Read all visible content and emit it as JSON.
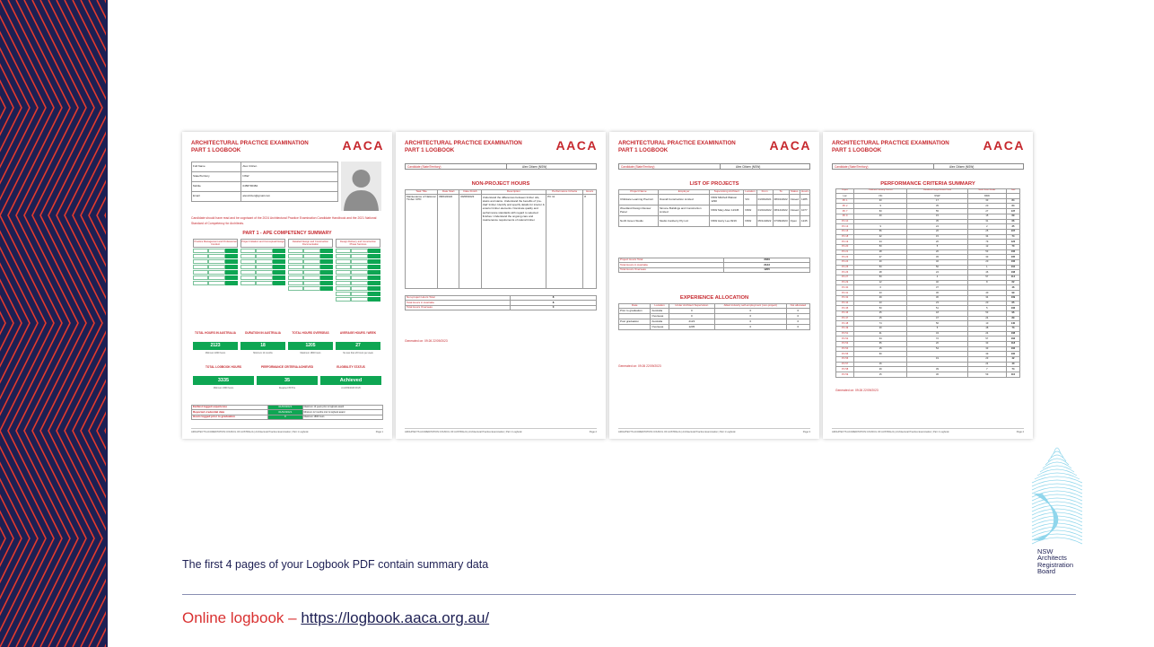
{
  "slide": {
    "caption": "The first 4 pages of your Logbook PDF contain summary data",
    "online_label": "Online logbook – ",
    "online_link": "https://logbook.aaca.org.au/",
    "brand_color": "#c6282e",
    "navy_color": "#1d1f53",
    "green_color": "#0ea653"
  },
  "logo": {
    "lines": [
      "NSW",
      "Architects",
      "Registration",
      "Board"
    ]
  },
  "doc": {
    "title_line1": "ARCHITECTURAL PRACTICE EXAMINATION",
    "title_line2": "PART 1 LOGBOOK",
    "logo_text": "AACA",
    "footer": "ARCHITECTS ACCREDITATION COUNCIL OF AUSTRALIA | Architectural Practice Examination | Part 1 Logbook",
    "generated": "Generated on: 09:26 22/09/2023",
    "candidate_label": "Candidate (State/Territory)",
    "candidate_value": "Alex Citizen  (NSW)"
  },
  "page1": {
    "page_num": "Page 1",
    "info": [
      {
        "label": "Full Name",
        "value": "Alex Citizen"
      },
      {
        "label": "State/Territory",
        "value": "NSW"
      },
      {
        "label": "Mobile",
        "value": "0458736384"
      },
      {
        "label": "Email",
        "value": "alexcitizen@gmail.com"
      }
    ],
    "disclaimer": "Candidate should have read and be cognisant of the 2024 Architectural Practice Examination Candidate Handbook and the 2021 National Standard of Competency for Architects.",
    "section_title": "PART 1 - APE COMPETENCY SUMMARY",
    "columns": [
      "Practice Management and Professional Conduct",
      "Project Initiation and Conceptual Design",
      "Detailed Design and Construction Documentation",
      "Design Delivery and Construction Phase Services"
    ],
    "stats1": [
      {
        "label": "TOTAL HOURS IN AUSTRALIA",
        "value": "2123",
        "note": "Minimum 1800 hours"
      },
      {
        "label": "DURATION IN AUSTRALIA",
        "value": "18",
        "note": "Minimum 12 months"
      },
      {
        "label": "TOTAL HOURS OVERSEAS",
        "value": "1205",
        "note": "Maximum 1800 hours"
      },
      {
        "label": "AVERAGE HOURS / WEEK",
        "value": "27",
        "note": "No less than 20 hours per week"
      }
    ],
    "stats2": [
      {
        "label": "TOTAL LOGBOOK HOURS",
        "value": "3335",
        "note": "Minimum 3300 hours"
      },
      {
        "label": "PERFORMANCE CRITERIA ACHIEVED",
        "value": "35",
        "note": "Required 35 PCs"
      },
      {
        "label": "ELIGIBILITY STATUS",
        "value": "Achieved",
        "note": "At 22/09/2023 09:26"
      }
    ],
    "dates": [
      {
        "label": "Earliest logged experience",
        "value": "01/03/2021",
        "note": "Maximum 10 years prior to logbook award"
      },
      {
        "label": "Reported credential date",
        "value": "01/02/2021",
        "note": "Minimum 12 months prior to logbook award"
      },
      {
        "label": "Hours logged prior to graduation",
        "value": "0",
        "note": "Maximum 1800 hours"
      }
    ]
  },
  "page2": {
    "page_num": "Page 2",
    "heading": "NON-PROJECT HOURS",
    "headers": [
      "Task Title",
      "Date Start",
      "Date Finish",
      "Description",
      "Performance Criteria",
      "Hours"
    ],
    "row": [
      "Maintenance of National Timber CPD",
      "08/04/2022",
      "09/08/2023",
      "Understand the differences between timber oils, stains and stains. Understand the benefits of 'pre-clad' timber. Identify and specify details for interior & exterior timber elements. Nominate quality and performance standards with regard to selected finishes. Understand the ongoing care and maintenance requirements of natural timber.",
      "PC 11",
      "8"
    ],
    "totals": [
      {
        "label": "Non-project Hours Total",
        "value": "8"
      },
      {
        "label": "Total Hours in Australia",
        "value": "8"
      },
      {
        "label": "Total Hours Overseas",
        "value": "0"
      }
    ]
  },
  "page3": {
    "page_num": "Page 3",
    "heading": "LIST OF PROJECTS",
    "headers": [
      "Project Name",
      "Employer",
      "Supervising Architect",
      "Location",
      "From",
      "To",
      "Status",
      "Hours"
    ],
    "rows": [
      [
        "Childcare Learning Precinct",
        "Overall Construction Limited",
        "NSW Mitchell Watson 1290",
        "VIC",
        "01/03/2021",
        "08/01/2022",
        "Closed",
        "1285"
      ],
      [
        "Woodland Design Review Panel",
        "Simone Buildings and Construction Limited",
        "NSW Mary Allen 12345",
        "NSW",
        "01/01/2022",
        "08/12/2022",
        "Closed",
        "1077"
      ],
      [
        "North Green Studio",
        "Studio Canberry Pty Ltd",
        "NSW Harry Lee 8219",
        "NSW",
        "05/11/2022",
        "07/09/2023",
        "Open",
        "1245"
      ]
    ],
    "totals": [
      {
        "label": "Project Hours Total",
        "value": "3329"
      },
      {
        "label": "Total Hours in Australia",
        "value": "2123"
      },
      {
        "label": "Total Hours Overseas",
        "value": "1205"
      }
    ],
    "alloc_heading": "EXPERIENCE ALLOCATION",
    "alloc_headers": [
      "Date",
      "Location",
      "Under Architect Supervision",
      "Allied industry self-employment (non-project)",
      "Not allocated"
    ],
    "alloc_rows": [
      [
        "Prior to graduation",
        "Australia",
        "0",
        "0",
        "0"
      ],
      [
        "",
        "Overseas",
        "0",
        "0",
        "0"
      ],
      [
        "Post graduation",
        "Australia",
        "2123",
        "0",
        "0"
      ],
      [
        "",
        "Overseas",
        "1205",
        "0",
        "0"
      ]
    ]
  },
  "page4": {
    "page_num": "Page 4",
    "heading": "PERFORMANCE CRITERIA SUMMARY",
    "headers": [
      "Project",
      "Childcare Learning Precinct",
      "Woodland Design Review Panel",
      "North Green Studio",
      "Total"
    ],
    "subheaders": [
      "Loc",
      "VIC",
      "NSW",
      "NSW",
      ""
    ],
    "rows": [
      [
        "PC 1",
        "33",
        "17",
        "33",
        "84"
      ],
      [
        "PC 2",
        "9",
        "35",
        "20",
        "64"
      ],
      [
        "PC 7",
        "53",
        "55",
        "27",
        "137"
      ],
      [
        "PC 9",
        "40",
        "15",
        "15",
        "69"
      ],
      [
        "PC 10",
        "",
        "35",
        "31",
        "66"
      ],
      [
        "PC 13",
        "9",
        "24",
        "2",
        "35"
      ],
      [
        "PC 15",
        "56",
        "26",
        "25",
        "107"
      ],
      [
        "PC 18",
        "42",
        "15",
        "34",
        "74"
      ],
      [
        "PC 19",
        "24",
        "20",
        "79",
        "123"
      ],
      [
        "PC 20",
        "53",
        "5",
        "12",
        "70"
      ],
      [
        "PC 21",
        "28",
        "20",
        "53",
        "106"
      ],
      [
        "PC 23",
        "27",
        "45",
        "33",
        "105"
      ],
      [
        "PC 24",
        "40",
        "46",
        "20",
        "106"
      ],
      [
        "PC 25",
        "53",
        "50",
        "1",
        "104"
      ],
      [
        "PC 26",
        "28",
        "24",
        "46",
        "108"
      ],
      [
        "PC 27",
        "53",
        "4",
        "57",
        "114"
      ],
      [
        "PC 29",
        "12",
        "40",
        "8",
        "62"
      ],
      [
        "PC 30",
        "6",
        "37",
        "",
        "46"
      ],
      [
        "PC 31",
        "23",
        "36",
        "40",
        "99"
      ],
      [
        "PC 32",
        "49",
        "30",
        "34",
        "109"
      ],
      [
        "PC 44",
        "23",
        "23",
        "20",
        "65"
      ],
      [
        "PC 45",
        "53",
        "51",
        "5",
        "106"
      ],
      [
        "PC 46",
        "25",
        "18",
        "53",
        "96"
      ],
      [
        "PC 47",
        "15",
        "47",
        "24",
        "89"
      ],
      [
        "PC 48",
        "74",
        "56",
        "10",
        "140"
      ],
      [
        "PC 49",
        "20",
        "5",
        "48",
        "73"
      ],
      [
        "PC 51",
        "41",
        "43",
        "24",
        "108"
      ],
      [
        "PC 52",
        "34",
        "72",
        "57",
        "163"
      ],
      [
        "PC 53",
        "65",
        "20",
        "33",
        "118"
      ],
      [
        "PC 54",
        "15",
        "54",
        "33",
        "102"
      ],
      [
        "PC 55",
        "60",
        "",
        "39",
        "100"
      ],
      [
        "PC 56",
        "",
        "19",
        "23",
        "42"
      ],
      [
        "PC 57",
        "16",
        "",
        "24",
        "40"
      ],
      [
        "PC 58",
        "29",
        "39",
        "7",
        "74"
      ],
      [
        "PC 59",
        "15",
        "36",
        "59",
        "110"
      ]
    ]
  }
}
